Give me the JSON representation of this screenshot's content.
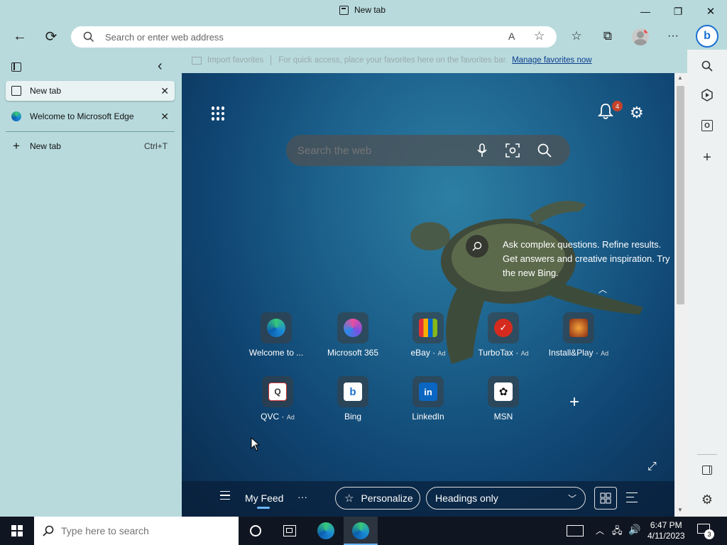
{
  "window": {
    "title": "New tab",
    "minimize": "—",
    "restore": "❐",
    "close": "✕"
  },
  "toolbar": {
    "back": "←",
    "refresh": "⟳",
    "address_placeholder": "Search or enter web address",
    "read_aloud": "A",
    "add_favorite": "☆",
    "favorites": "☆",
    "collections": "⧉",
    "more": "···"
  },
  "sidebar": {
    "tabs": [
      {
        "label": "New tab",
        "close": "✕"
      },
      {
        "label": "Welcome to Microsoft Edge",
        "close": "✕"
      }
    ],
    "new_tab": {
      "label": "New tab",
      "shortcut": "Ctrl+T",
      "plus": "+"
    },
    "collapse": "‹"
  },
  "favbar": {
    "import": "Import favorites",
    "hint": "For quick access, place your favorites here on the favorites bar.",
    "manage": "Manage favorites now"
  },
  "newtab": {
    "search_placeholder": "Search the web",
    "notification_count": "4",
    "bing_promo": [
      "Ask complex questions. Refine results.",
      "Get answers and creative inspiration. Try",
      "the new Bing."
    ],
    "tiles": [
      {
        "label": "Welcome to ...",
        "ad": "",
        "icon": "edge-icon",
        "color": "#1f8fd1"
      },
      {
        "label": "Microsoft 365",
        "ad": "",
        "icon": "m365-icon",
        "color": "#7b4fe0"
      },
      {
        "label": "eBay",
        "ad": "Ad",
        "icon": "ebay-icon",
        "color": "#e43137"
      },
      {
        "label": "TurboTax",
        "ad": "Ad",
        "icon": "turbotax-icon",
        "color": "#d52b1e"
      },
      {
        "label": "Install&Play",
        "ad": "Ad",
        "icon": "game-icon",
        "color": "#b5471f"
      },
      {
        "label": "QVC",
        "ad": "Ad",
        "icon": "qvc-icon",
        "color": "#ffffff"
      },
      {
        "label": "Bing",
        "ad": "",
        "icon": "bing-icon",
        "color": "#ffffff"
      },
      {
        "label": "LinkedIn",
        "ad": "",
        "icon": "linkedin-icon",
        "color": "#0a66c2"
      },
      {
        "label": "MSN",
        "ad": "",
        "icon": "msn-icon",
        "color": "#ffffff"
      }
    ],
    "add_tile": "+",
    "feed": {
      "my_feed": "My Feed",
      "more": "···",
      "personalize": "Personalize",
      "headings": "Headings only"
    }
  },
  "taskbar": {
    "search_placeholder": "Type here to search",
    "time": "6:47 PM",
    "date": "4/11/2023",
    "notif_count": "3"
  }
}
